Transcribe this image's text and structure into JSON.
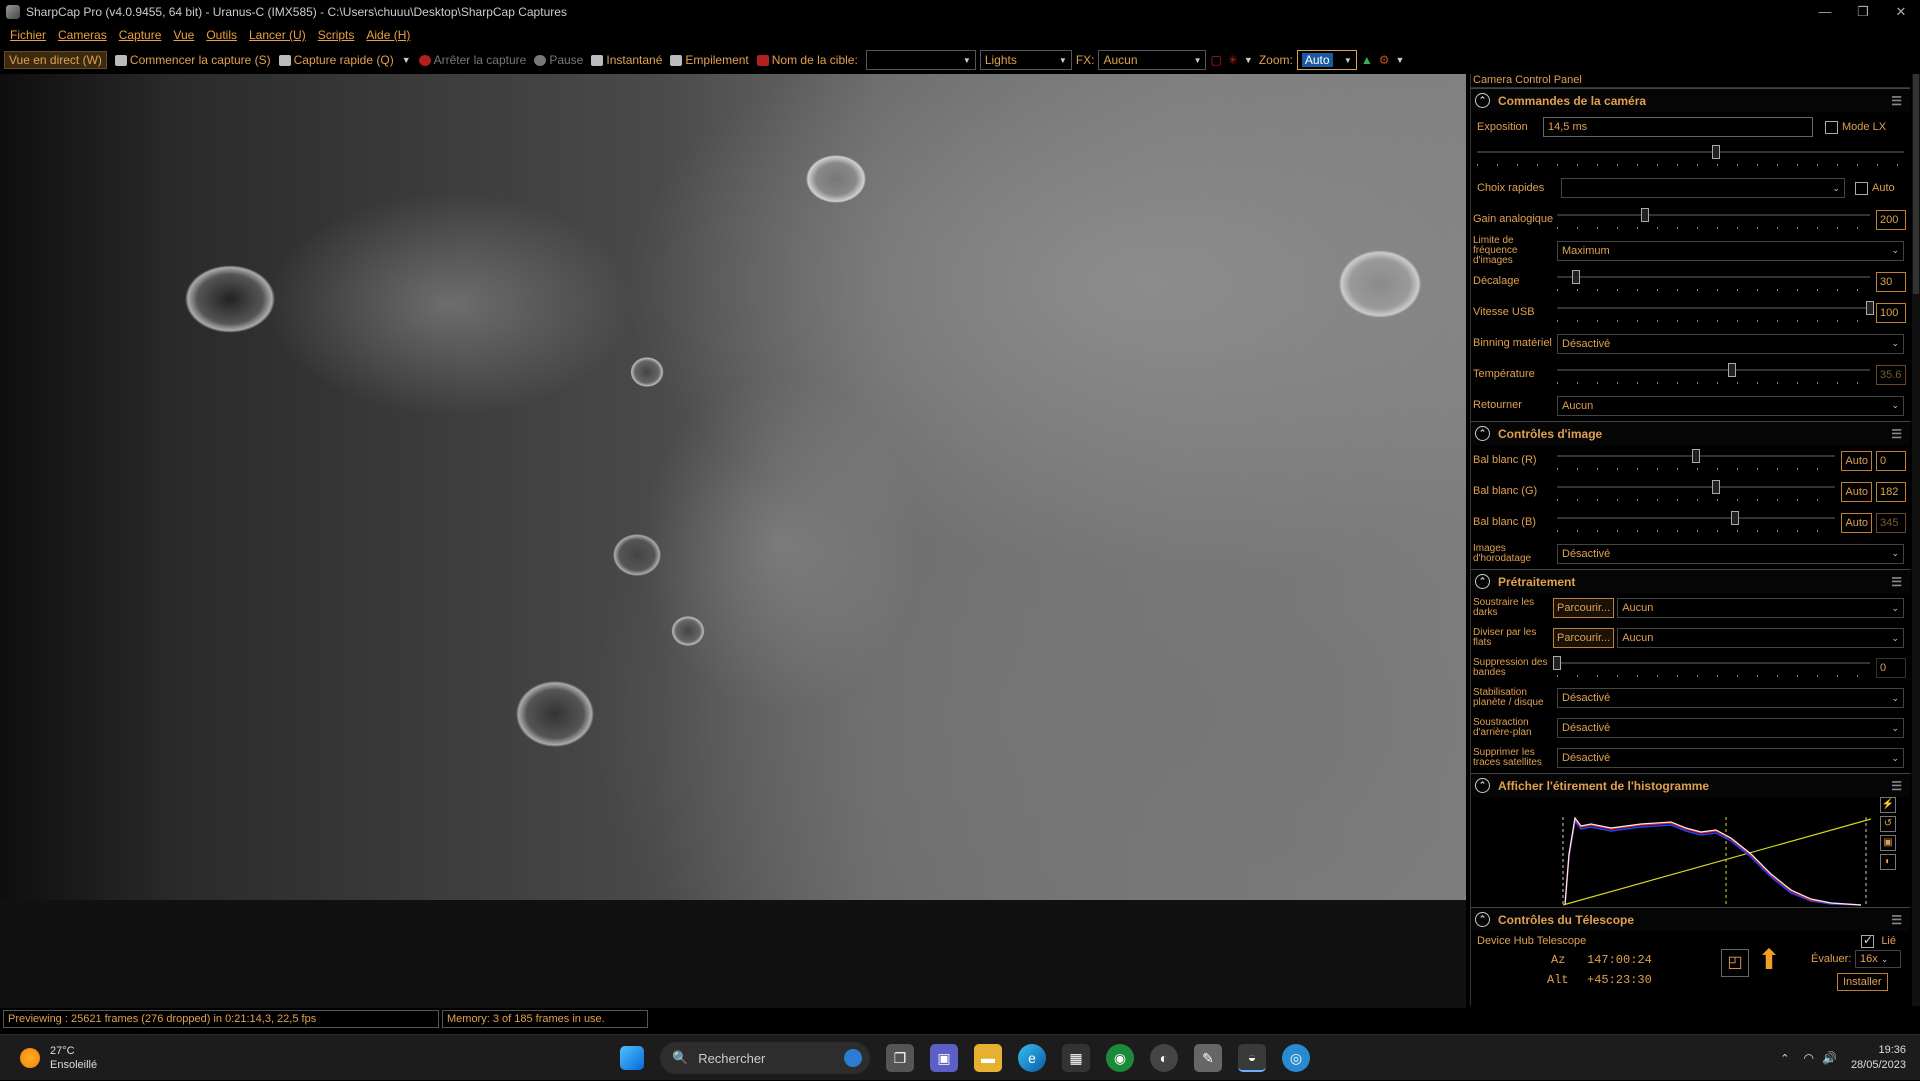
{
  "window": {
    "title": "SharpCap Pro (v4.0.9455, 64 bit) - Uranus-C (IMX585) - C:\\Users\\chuuu\\Desktop\\SharpCap Captures",
    "minimize": "—",
    "maximize": "❐",
    "close": "✕"
  },
  "menu": [
    "Fichier",
    "Cameras",
    "Capture",
    "Vue",
    "Outils",
    "Lancer (U)",
    "Scripts",
    "Aide (H)"
  ],
  "toolbar": {
    "live_view": "Vue en direct (W)",
    "start_capture": "Commencer la capture (S)",
    "quick_capture": "Capture rapide (Q)",
    "stop_capture": "Arrêter la capture",
    "pause": "Pause",
    "snapshot": "Instantané",
    "stacking": "Empilement",
    "target_name_label": "Nom de la cible:",
    "target_name_value": "",
    "frame_type": "Lights",
    "fx_label": "FX:",
    "fx_value": "Aucun",
    "zoom_label": "Zoom:",
    "zoom_value": "Auto"
  },
  "panel": {
    "title": "Camera Control Panel",
    "camera_controls": {
      "header": "Commandes de la caméra",
      "exposure_label": "Exposition",
      "exposure_value": "14,5 ms",
      "lx_mode": "Mode LX",
      "quick_picks_label": "Choix rapides",
      "auto_label": "Auto",
      "gain_label": "Gain analogique",
      "gain_value": "200",
      "gain_fraction": 0.28,
      "fps_limit_label": "Limite de fréquence d'images",
      "fps_limit_value": "Maximum",
      "offset_label": "Décalage",
      "offset_value": "30",
      "offset_fraction": 0.06,
      "usb_label": "Vitesse USB",
      "usb_value": "100",
      "usb_fraction": 1.0,
      "binning_label": "Binning matériel",
      "binning_value": "Désactivé",
      "temp_label": "Température",
      "temp_value": "35.6",
      "temp_fraction": 0.56,
      "flip_label": "Retourner",
      "flip_value": "Aucun"
    },
    "image_controls": {
      "header": "Contrôles d'image",
      "wb_r_label": "Bal blanc (R)",
      "wb_r_value": "0",
      "wb_r_fraction": 0.5,
      "wb_g_label": "Bal blanc (G)",
      "wb_g_value": "182",
      "wb_g_fraction": 0.57,
      "wb_b_label": "Bal blanc (B)",
      "wb_b_value": "345",
      "wb_b_fraction": 0.64,
      "auto_btn": "Auto",
      "timestamp_label": "Images d'horodatage",
      "timestamp_value": "Désactivé"
    },
    "preprocessing": {
      "header": "Prétraitement",
      "darks_label": "Soustraire les darks",
      "flats_label": "Diviser par les flats",
      "browse": "Parcourir...",
      "darks_value": "Aucun",
      "flats_value": "Aucun",
      "banding_label": "Suppression des bandes",
      "banding_value": "0",
      "banding_fraction": 0.0,
      "stab_label": "Stabilisation planète / disque",
      "stab_value": "Désactivé",
      "bg_label": "Soustraction d'arrière-plan",
      "bg_value": "Désactivé",
      "sat_label": "Supprimer les traces satellites",
      "sat_value": "Désactivé"
    },
    "histogram": {
      "header": "Afficher l'étirement de l'histogramme"
    },
    "telescope": {
      "header": "Contrôles du Télescope",
      "device": "Device Hub Telescope",
      "linked": "Lié",
      "az_label": "Az",
      "az_value": "147:00:24",
      "alt_label": "Alt",
      "alt_value": "+45:23:30",
      "rate_label": "Évaluer:",
      "rate_value": "16x",
      "install": "Installer"
    }
  },
  "status": {
    "preview": "Previewing : 25621 frames (276 dropped) in 0:21:14,3, 22,5 fps",
    "memory": "Memory: 3 of 185 frames in use."
  },
  "taskbar": {
    "temp": "27°C",
    "weather": "Ensoleillé",
    "search": "Rechercher",
    "time": "19:36",
    "date": "28/05/2023"
  }
}
